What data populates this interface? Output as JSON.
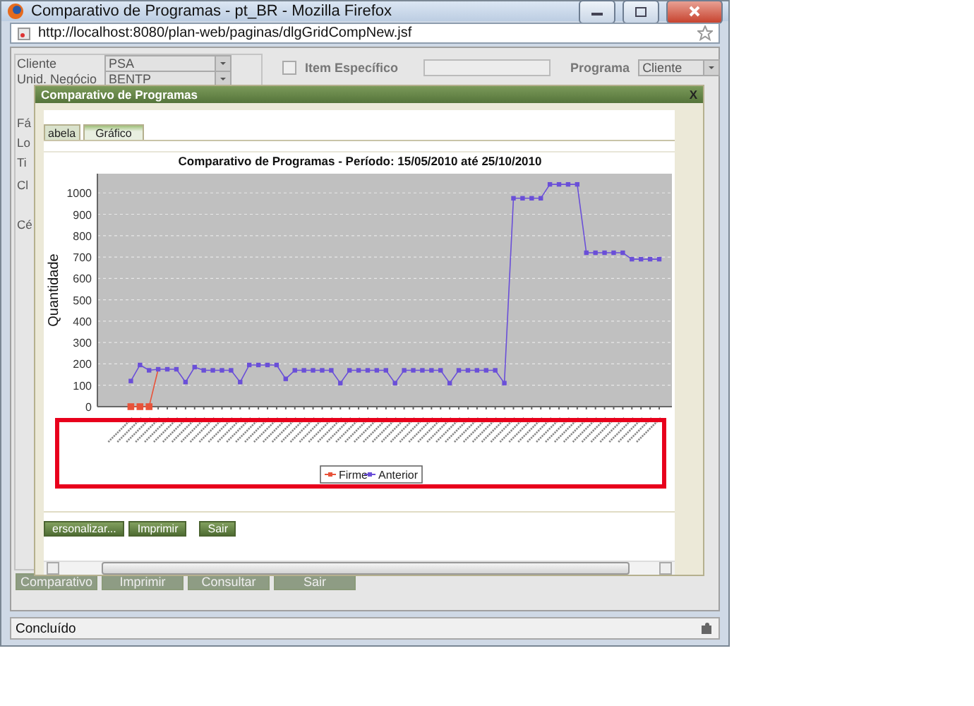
{
  "browser": {
    "title": "Comparativo de Programas - pt_BR - Mozilla Firefox",
    "url": "http://localhost:8080/plan-web/paginas/dlgGridCompNew.jsf",
    "status": "Concluído"
  },
  "form": {
    "fields": [
      {
        "label": "Cliente",
        "value": "PSA"
      },
      {
        "label": "Unid. Negócio",
        "value": "BENTP"
      }
    ],
    "item_especifico": {
      "label": "Item Específico",
      "checked": false
    },
    "programa": {
      "label": "Programa",
      "value": "Cliente"
    },
    "cut_labels": [
      "Fá",
      "Lo",
      "Ti",
      "Cl",
      "Cé"
    ],
    "buttons": [
      "Comparativo",
      "Imprimir",
      "Consultar",
      "Sair"
    ]
  },
  "dialog": {
    "title": "Comparativo de Programas",
    "close": "X",
    "tabs": [
      {
        "label": "abela",
        "selected": false
      },
      {
        "label": "Gráfico",
        "selected": true
      }
    ],
    "chart_data": {
      "type": "line",
      "title": "Comparativo de Programas - Período: 15/05/2010 até 25/10/2010",
      "ylabel": "Quantidade",
      "ylim": [
        0,
        1090
      ],
      "grid": true,
      "legend": "bottom",
      "yticks": [
        0,
        100,
        200,
        300,
        400,
        500,
        600,
        700,
        800,
        900,
        1000
      ],
      "series": [
        {
          "name": "Firme",
          "color": "#e8533a",
          "marker": "square",
          "values": [
            0,
            0,
            0,
            175,
            null,
            null,
            null,
            null,
            null,
            null,
            null,
            null,
            null,
            null,
            null,
            null,
            null,
            null,
            null,
            null,
            null,
            null,
            null,
            null,
            null,
            null,
            null,
            null,
            null,
            null,
            null,
            null,
            null,
            null,
            null,
            null,
            null,
            null,
            null,
            null,
            null,
            null,
            null,
            null,
            null,
            null,
            null,
            null,
            null,
            null,
            null,
            null,
            null,
            null,
            null,
            null,
            null,
            null,
            null
          ]
        },
        {
          "name": "Anterior",
          "color": "#6a4fd8",
          "marker": "square",
          "values": [
            120,
            195,
            170,
            175,
            175,
            175,
            115,
            185,
            170,
            170,
            170,
            170,
            115,
            195,
            195,
            195,
            195,
            130,
            170,
            170,
            170,
            170,
            170,
            110,
            170,
            170,
            170,
            170,
            170,
            110,
            170,
            170,
            170,
            170,
            170,
            110,
            170,
            170,
            170,
            170,
            170,
            110,
            975,
            975,
            975,
            975,
            1040,
            1040,
            1040,
            1040,
            720,
            720,
            720,
            720,
            720,
            690,
            690,
            690,
            690
          ]
        }
      ]
    },
    "buttons": [
      "ersonalizar...",
      "Imprimir",
      "Sair"
    ]
  }
}
